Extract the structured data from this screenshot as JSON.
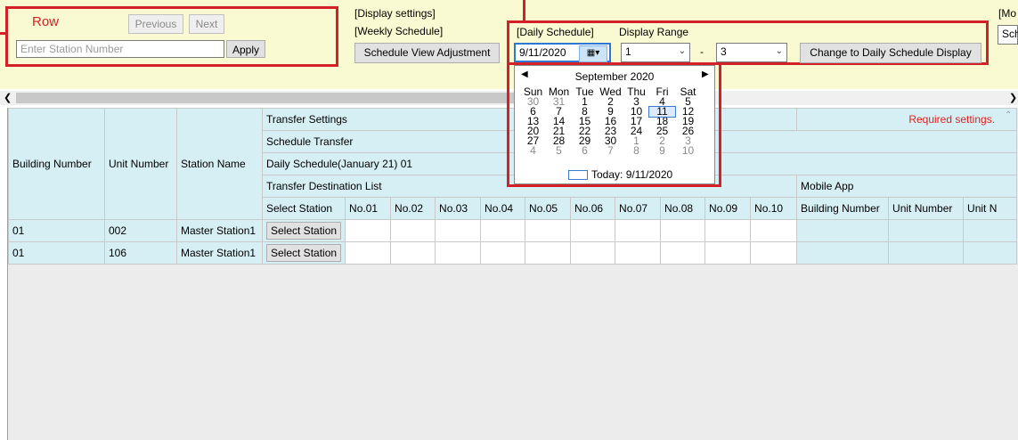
{
  "row_panel": {
    "title": "Row",
    "previous_label": "Previous",
    "next_label": "Next",
    "station_placeholder": "Enter Station Number",
    "apply_label": "Apply"
  },
  "display_settings": {
    "heading": "[Display settings]",
    "weekly_heading": "[Weekly Schedule]",
    "adjust_label": "Schedule View Adjustment"
  },
  "daily_panel": {
    "heading": "[Daily Schedule]",
    "range_label": "Display Range",
    "date_value": "9/11/2020",
    "range_from": "1",
    "range_dash": "-",
    "range_to": "3",
    "change_label": "Change to Daily Schedule Display"
  },
  "right_edge": {
    "mo_heading": "[Mo",
    "sch_label": "Sch"
  },
  "calendar": {
    "month_label": "September 2020",
    "weekdays": [
      "Sun",
      "Mon",
      "Tue",
      "Wed",
      "Thu",
      "Fri",
      "Sat"
    ],
    "weeks": [
      [
        "30",
        "31",
        "1",
        "2",
        "3",
        "4",
        "5"
      ],
      [
        "6",
        "7",
        "8",
        "9",
        "10",
        "11",
        "12"
      ],
      [
        "13",
        "14",
        "15",
        "16",
        "17",
        "18",
        "19"
      ],
      [
        "20",
        "21",
        "22",
        "23",
        "24",
        "25",
        "26"
      ],
      [
        "27",
        "28",
        "29",
        "30",
        "1",
        "2",
        "3"
      ],
      [
        "4",
        "5",
        "6",
        "7",
        "8",
        "9",
        "10"
      ]
    ],
    "today_label": "Today: 9/11/2020"
  },
  "grid": {
    "col_building": "Building Number",
    "col_unit": "Unit Number",
    "col_station": "Station Name",
    "transfer_settings": "Transfer Settings",
    "required": "Required settings.",
    "schedule_transfer": "Schedule Transfer",
    "daily_schedule": "Daily Schedule(January 21) 01",
    "dest_list": "Transfer Destination List",
    "mobile_app": "Mobile App",
    "select_station": "Select Station",
    "nos": [
      "No.01",
      "No.02",
      "No.03",
      "No.04",
      "No.05",
      "No.06",
      "No.07",
      "No.08",
      "No.09",
      "No.10"
    ],
    "mobile_building": "Building Number",
    "mobile_unit": "Unit Number",
    "mobile_unit_n": "Unit N",
    "rows": [
      {
        "building": "01",
        "unit": "002",
        "station": "Master Station1",
        "button": "Select Station"
      },
      {
        "building": "01",
        "unit": "106",
        "station": "Master Station1",
        "button": "Select Station"
      }
    ]
  }
}
